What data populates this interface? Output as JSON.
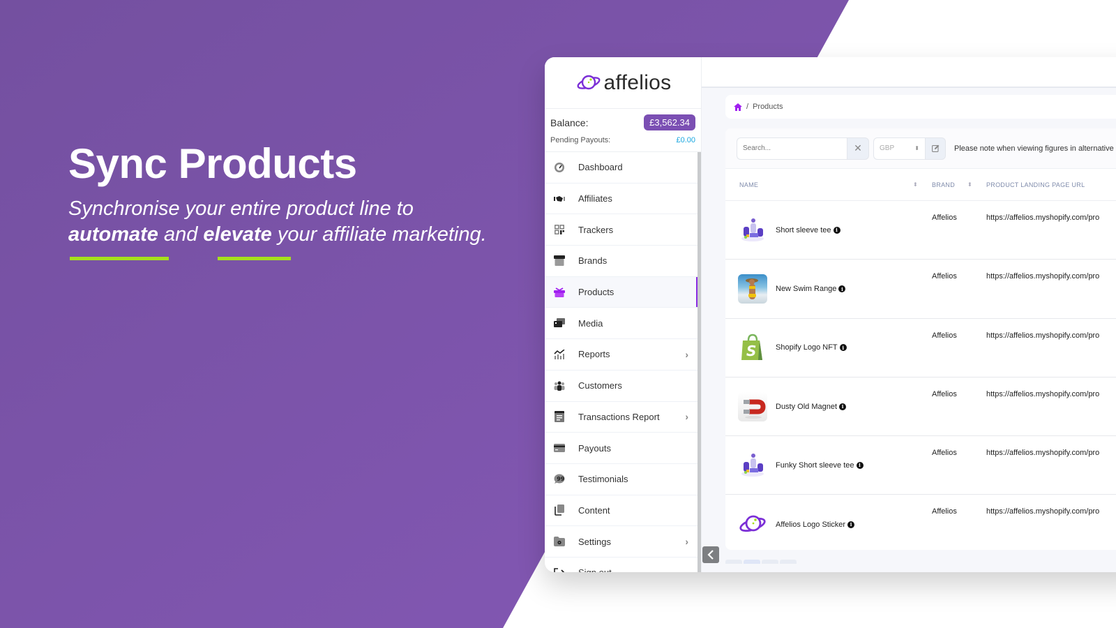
{
  "colors": {
    "brand_purple": "#7b4fb3",
    "accent_green": "#a6e01c",
    "active_indicator": "#8a2be2",
    "pending_blue": "#1aa7e0"
  },
  "hero": {
    "title": "Sync Products",
    "subtitle_line1": "Synchronise your entire product line to",
    "subtitle_bold1": "automate",
    "subtitle_mid": " and ",
    "subtitle_bold2": "elevate",
    "subtitle_end": " your affiliate marketing."
  },
  "app": {
    "logo_text": "affelios",
    "balance": {
      "label": "Balance:",
      "value": "£3,562.34",
      "pending_label": "Pending Payouts:",
      "pending_value": "£0.00"
    },
    "nav": [
      {
        "label": "Dashboard",
        "icon": "dashboard-gauge-icon",
        "has_submenu": false,
        "active": false
      },
      {
        "label": "Affiliates",
        "icon": "handshake-icon",
        "has_submenu": false,
        "active": false
      },
      {
        "label": "Trackers",
        "icon": "qr-code-icon",
        "has_submenu": false,
        "active": false
      },
      {
        "label": "Brands",
        "icon": "store-icon",
        "has_submenu": false,
        "active": false
      },
      {
        "label": "Products",
        "icon": "gift-box-icon",
        "has_submenu": false,
        "active": true
      },
      {
        "label": "Media",
        "icon": "photo-video-icon",
        "has_submenu": false,
        "active": false
      },
      {
        "label": "Reports",
        "icon": "chart-icon",
        "has_submenu": true,
        "active": false
      },
      {
        "label": "Customers",
        "icon": "users-icon",
        "has_submenu": false,
        "active": false
      },
      {
        "label": "Transactions Report",
        "icon": "receipt-icon",
        "has_submenu": true,
        "active": false
      },
      {
        "label": "Payouts",
        "icon": "credit-card-icon",
        "has_submenu": false,
        "active": false
      },
      {
        "label": "Testimonials",
        "icon": "quote-bubble-icon",
        "has_submenu": false,
        "active": false
      },
      {
        "label": "Content",
        "icon": "copy-icon",
        "has_submenu": false,
        "active": false
      },
      {
        "label": "Settings",
        "icon": "folder-gear-icon",
        "has_submenu": true,
        "active": false
      },
      {
        "label": "Sign out",
        "icon": "sign-out-icon",
        "has_submenu": false,
        "active": false
      }
    ],
    "breadcrumb": {
      "home_icon": "home-icon",
      "separator": "/",
      "current": "Products"
    },
    "filters": {
      "search_placeholder": "Search...",
      "search_value": "",
      "currency": "GBP",
      "note": "Please note when viewing figures in alternative"
    },
    "table": {
      "columns": [
        "NAME",
        "BRAND",
        "PRODUCT LANDING PAGE URL"
      ],
      "rows": [
        {
          "name": "Short sleeve tee",
          "brand": "Affelios",
          "url": "https://affelios.myshopify.com/pro",
          "thumb": "team-illustration"
        },
        {
          "name": "New Swim Range",
          "brand": "Affelios",
          "url": "https://affelios.myshopify.com/pro",
          "thumb": "swimwear-photo"
        },
        {
          "name": "Shopify Logo NFT",
          "brand": "Affelios",
          "url": "https://affelios.myshopify.com/pro",
          "thumb": "shopify-bag"
        },
        {
          "name": "Dusty Old Magnet",
          "brand": "Affelios",
          "url": "https://affelios.myshopify.com/pro",
          "thumb": "magnet"
        },
        {
          "name": "Funky Short sleeve tee",
          "brand": "Affelios",
          "url": "https://affelios.myshopify.com/pro",
          "thumb": "team-illustration"
        },
        {
          "name": "Affelios Logo Sticker",
          "brand": "Affelios",
          "url": "https://affelios.myshopify.com/pro",
          "thumb": "affelios-logo"
        }
      ]
    }
  }
}
